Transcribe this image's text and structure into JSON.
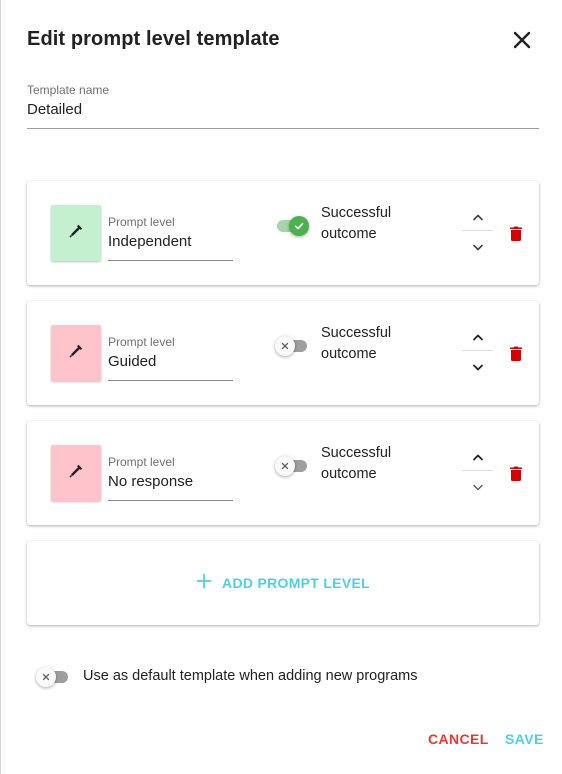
{
  "dialog": {
    "title": "Edit prompt level template",
    "close_icon": "close-icon"
  },
  "template_name": {
    "label": "Template name",
    "value": "Detailed"
  },
  "prompt_levels": [
    {
      "label": "Prompt level",
      "value": "Independent",
      "color": "#c4f0cf",
      "successful_outcome": true,
      "outcome_label": "Successful outcome",
      "icons": [
        "eyedropper-icon",
        "chevron-up-icon",
        "chevron-down-icon",
        "delete-icon"
      ]
    },
    {
      "label": "Prompt level",
      "value": "Guided",
      "color": "#ffc4cb",
      "successful_outcome": false,
      "outcome_label": "Successful outcome",
      "icons": [
        "eyedropper-icon",
        "chevron-up-icon",
        "chevron-down-icon",
        "delete-icon"
      ]
    },
    {
      "label": "Prompt level",
      "value": "No response",
      "color": "#ffc4cb",
      "successful_outcome": false,
      "outcome_label": "Successful outcome",
      "icons": [
        "eyedropper-icon",
        "chevron-up-icon",
        "chevron-down-icon",
        "delete-icon"
      ]
    }
  ],
  "add_prompt_level": {
    "label": "ADD PROMPT LEVEL",
    "icon": "plus-icon"
  },
  "default_template": {
    "label": "Use as default template when adding new programs",
    "enabled": false
  },
  "actions": {
    "cancel": "CANCEL",
    "save": "SAVE"
  },
  "colors": {
    "accent": "#4dd0e1",
    "danger": "#e53935",
    "delete": "#d50000",
    "toggle_on": "#4caf50"
  }
}
